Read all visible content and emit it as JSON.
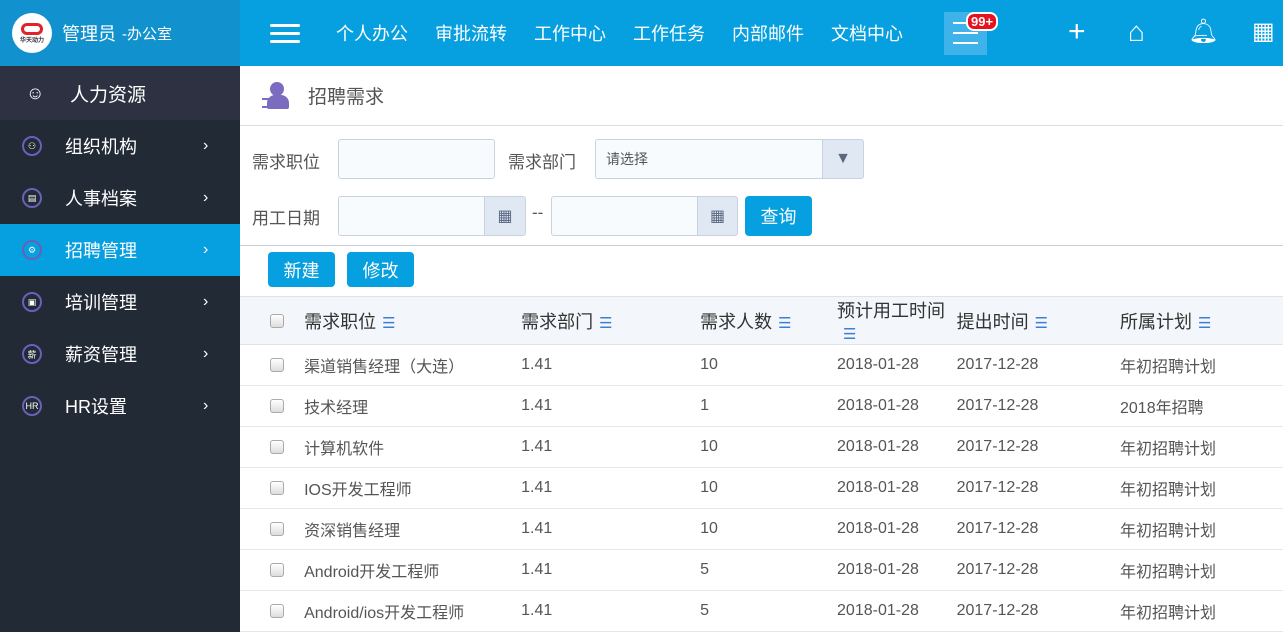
{
  "brand": {
    "logo_text": "华天动力",
    "title": "管理员",
    "subtitle": "-办公室"
  },
  "module": {
    "label": "人力资源",
    "icon": "user-list-icon"
  },
  "sidebar": {
    "items": [
      {
        "label": "组织机构",
        "icon": "org-icon",
        "glyph": "⚇"
      },
      {
        "label": "人事档案",
        "icon": "file-user-icon",
        "glyph": "▤"
      },
      {
        "label": "招聘管理",
        "icon": "recruit-icon",
        "glyph": "⚙",
        "active": true
      },
      {
        "label": "培训管理",
        "icon": "training-card-icon",
        "glyph": "▣"
      },
      {
        "label": "薪资管理",
        "icon": "salary-icon",
        "glyph": "薪"
      },
      {
        "label": "HR设置",
        "icon": "hr-icon",
        "glyph": "HR"
      }
    ]
  },
  "topnav": {
    "items": [
      "个人办公",
      "审批流转",
      "工作中心",
      "工作任务",
      "内部邮件",
      "文档中心"
    ],
    "badge": "99+"
  },
  "page": {
    "title": "招聘需求"
  },
  "filters": {
    "position_label": "需求职位",
    "position_value": "",
    "dept_label": "需求部门",
    "dept_placeholder": "请选择",
    "date_label": "用工日期",
    "date_sep": "--",
    "query": "查询"
  },
  "actions": {
    "new": "新建",
    "edit": "修改"
  },
  "table": {
    "headers": [
      "需求职位",
      "需求部门",
      "需求人数",
      "预计用工时间",
      "提出时间",
      "所属计划"
    ],
    "rows": [
      [
        "渠道销售经理（大连）",
        "1.41",
        "10",
        "2018-01-28",
        "2017-12-28",
        "年初招聘计划"
      ],
      [
        "技术经理",
        "1.41",
        "1",
        "2018-01-28",
        "2017-12-28",
        "2018年招聘"
      ],
      [
        "计算机软件",
        "1.41",
        "10",
        "2018-01-28",
        "2017-12-28",
        "年初招聘计划"
      ],
      [
        "IOS开发工程师",
        "1.41",
        "10",
        "2018-01-28",
        "2017-12-28",
        "年初招聘计划"
      ],
      [
        "资深销售经理",
        "1.41",
        "10",
        "2018-01-28",
        "2017-12-28",
        "年初招聘计划"
      ],
      [
        "Android开发工程师",
        "1.41",
        "5",
        "2018-01-28",
        "2017-12-28",
        "年初招聘计划"
      ],
      [
        "Android/ios开发工程师",
        "1.41",
        "5",
        "2018-01-28",
        "2017-12-28",
        "年初招聘计划"
      ]
    ]
  },
  "colors": {
    "primary": "#069fdf",
    "sidebar": "#222a36",
    "badge": "#e8121f"
  }
}
